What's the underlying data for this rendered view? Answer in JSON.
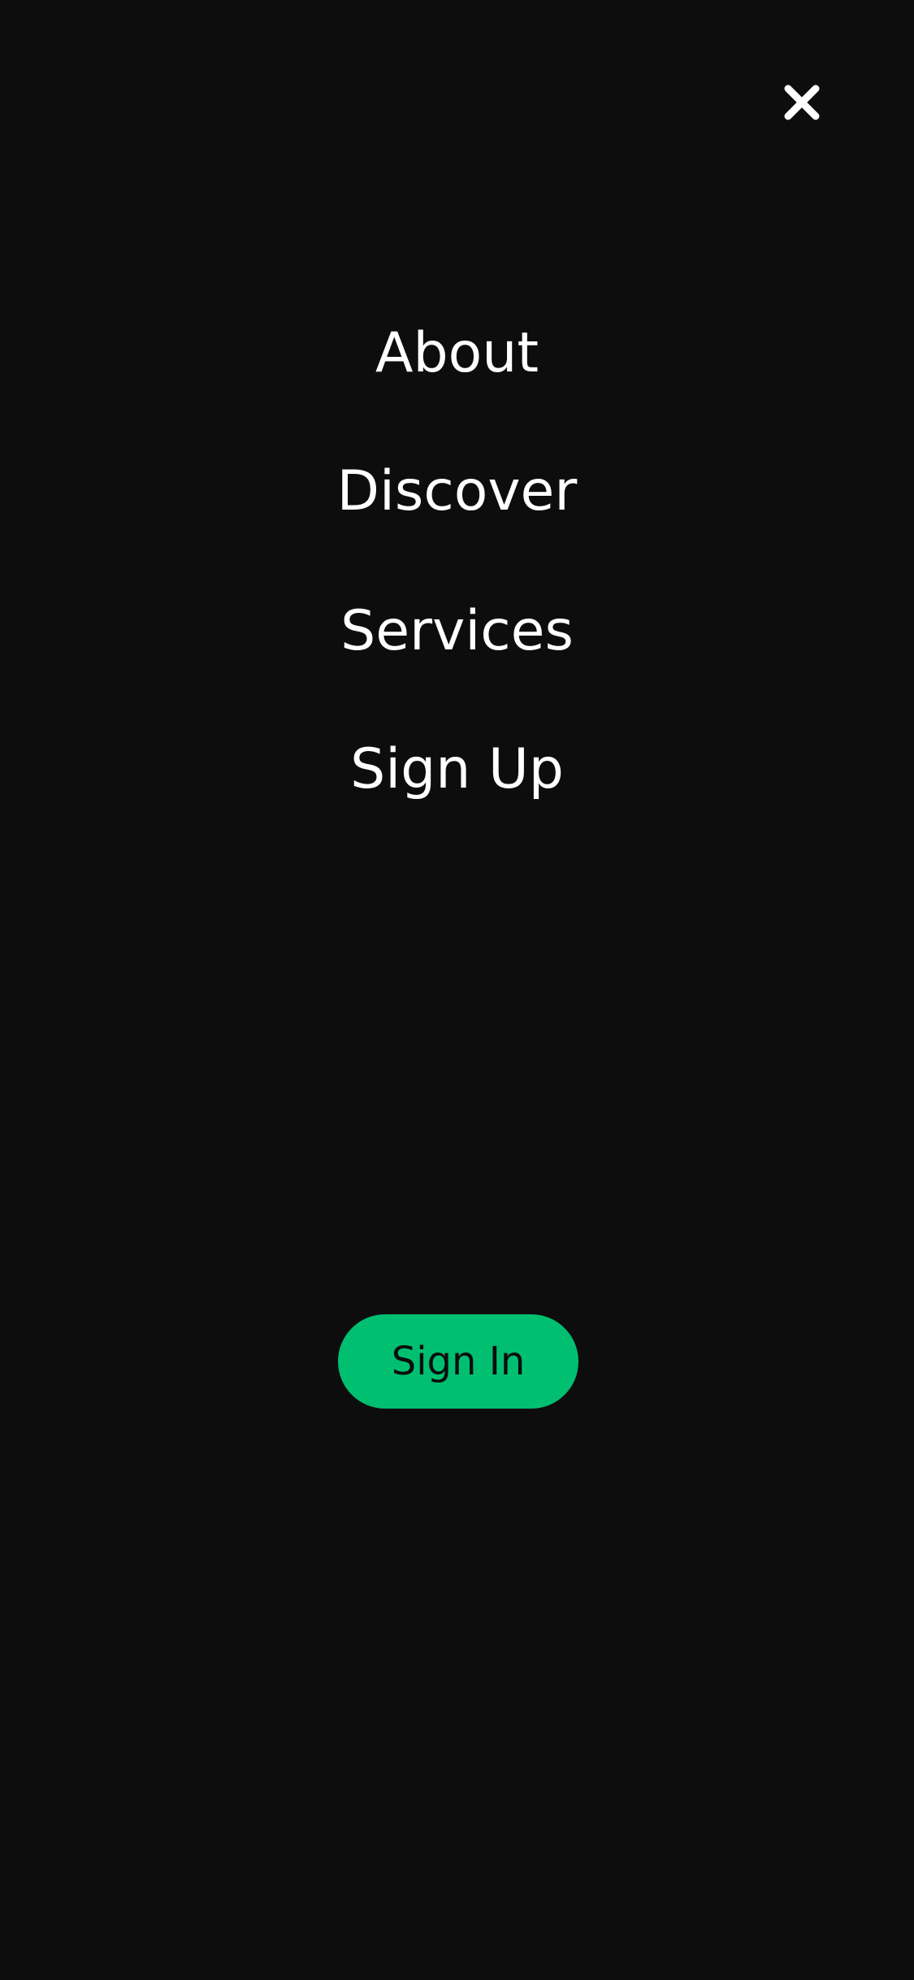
{
  "close": {
    "icon": "close-icon",
    "color": "#ffffff"
  },
  "menu": {
    "items": [
      {
        "label": "About"
      },
      {
        "label": "Discover"
      },
      {
        "label": "Services"
      },
      {
        "label": "Sign Up"
      }
    ]
  },
  "signin": {
    "label": "Sign In",
    "color": "#01bf71"
  },
  "theme": {
    "background": "#0d0d0d",
    "text": "#ffffff"
  }
}
